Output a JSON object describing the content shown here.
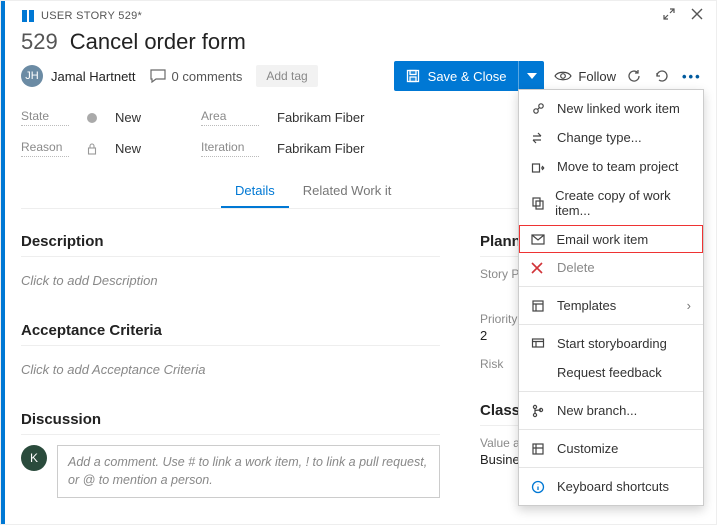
{
  "crumb": {
    "label": "USER STORY 529*"
  },
  "title": {
    "number": "529",
    "text": "Cancel order form"
  },
  "assignee": {
    "name": "Jamal Hartnett",
    "initials": "JH"
  },
  "comments": {
    "label": "0 comments"
  },
  "add_tag": "Add tag",
  "save_btn": "Save & Close",
  "follow_label": "Follow",
  "state": {
    "label": "State",
    "value": "New"
  },
  "reason": {
    "label": "Reason",
    "value": "New"
  },
  "area": {
    "label": "Area",
    "value": "Fabrikam Fiber"
  },
  "iteration": {
    "label": "Iteration",
    "value": "Fabrikam Fiber"
  },
  "tabs": {
    "details": "Details",
    "related": "Related Work it"
  },
  "description": {
    "heading": "Description",
    "placeholder": "Click to add Description"
  },
  "acceptance": {
    "heading": "Acceptance Criteria",
    "placeholder": "Click to add Acceptance Criteria"
  },
  "discussion": {
    "heading": "Discussion",
    "avatar": "K",
    "placeholder": "Add a comment. Use # to link a work item, ! to link a pull request, or @ to mention a person."
  },
  "planning": {
    "heading": "Planning",
    "story_points_label": "Story Points",
    "priority_label": "Priority",
    "priority_value": "2",
    "risk_label": "Risk"
  },
  "classification": {
    "heading": "Classificati",
    "value_area_label": "Value area",
    "value_area_value": "Business"
  },
  "menu": {
    "new_linked": "New linked work item",
    "change_type": "Change type...",
    "move_project": "Move to team project",
    "create_copy": "Create copy of work item...",
    "email": "Email work item",
    "delete": "Delete",
    "templates": "Templates",
    "storyboard": "Start storyboarding",
    "feedback": "Request feedback",
    "new_branch": "New branch...",
    "customize": "Customize",
    "shortcuts": "Keyboard shortcuts"
  }
}
